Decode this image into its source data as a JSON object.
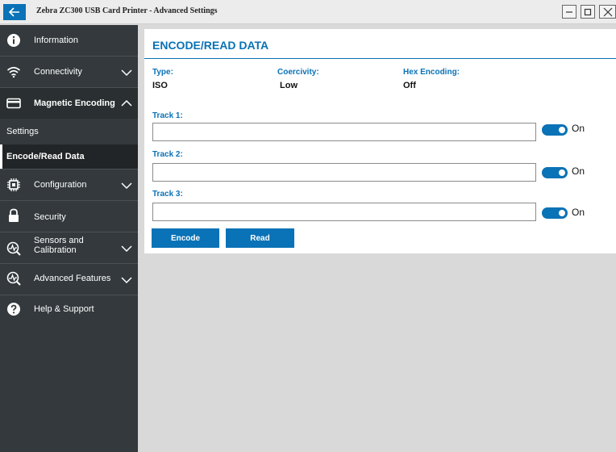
{
  "window": {
    "title": "Zebra ZC300 USB Card Printer - Advanced Settings"
  },
  "sidebar": {
    "items": [
      {
        "label": "Information",
        "icon": "info-icon"
      },
      {
        "label": "Connectivity",
        "icon": "wifi-icon",
        "chevron": "down"
      },
      {
        "label": "Magnetic Encoding",
        "icon": "card-icon",
        "chevron": "up"
      },
      {
        "label": "Configuration",
        "icon": "chip-icon",
        "chevron": "down"
      },
      {
        "label": "Security",
        "icon": "lock-icon"
      },
      {
        "label": "Sensors and Calibration",
        "label_line1": "Sensors and",
        "label_line2": "Calibration",
        "icon": "sensor-icon",
        "chevron": "down"
      },
      {
        "label": "Advanced Features",
        "icon": "gauge-icon",
        "chevron": "down"
      },
      {
        "label": "Help & Support",
        "icon": "help-icon"
      }
    ],
    "sub_items": [
      {
        "label": "Settings"
      },
      {
        "label": "Encode/Read Data",
        "active": true
      }
    ]
  },
  "main": {
    "title": "ENCODE/READ DATA",
    "fields": {
      "type_label": "Type:",
      "type_value": "ISO",
      "coercivity_label": "Coercivity:",
      "coercivity_value": "Low",
      "hex_label": "Hex Encoding:",
      "hex_value": "Off"
    },
    "tracks": [
      {
        "label": "Track 1:",
        "value": "",
        "toggle": "On"
      },
      {
        "label": "Track 2:",
        "value": "",
        "toggle": "On"
      },
      {
        "label": "Track 3:",
        "value": "",
        "toggle": "On"
      }
    ],
    "buttons": {
      "encode": "Encode",
      "read": "Read"
    }
  },
  "colors": {
    "accent": "#0a72b6",
    "sidebar_bg": "#33393c",
    "content_bg": "#d9d9d9"
  }
}
